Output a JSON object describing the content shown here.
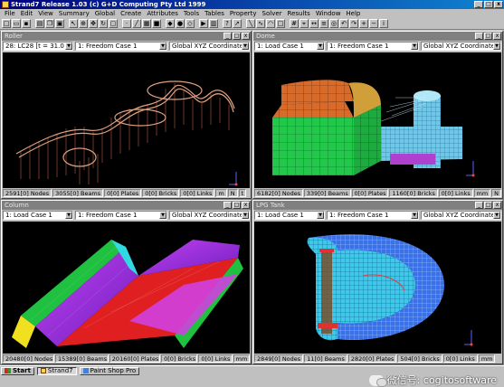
{
  "app": {
    "title": "Strand7 Release 1.03 (c) G+D Computing Pty Ltd 1999",
    "window_buttons": [
      "_",
      "□",
      "x"
    ]
  },
  "menu": [
    {
      "label": "File"
    },
    {
      "label": "Edit"
    },
    {
      "label": "View"
    },
    {
      "label": "Summary"
    },
    {
      "label": "Global"
    },
    {
      "label": "Create"
    },
    {
      "label": "Attributes"
    },
    {
      "label": "Tools"
    },
    {
      "label": "Tables"
    },
    {
      "label": "Property"
    },
    {
      "label": "Solver"
    },
    {
      "label": "Results"
    },
    {
      "label": "Window"
    },
    {
      "label": "Help"
    }
  ],
  "toolbar_icons": [
    "new-icon",
    "open-icon",
    "save-icon",
    "sep",
    "print-icon",
    "copy-icon",
    "paste-icon",
    "sep",
    "select-icon",
    "zoom-icon",
    "pan-icon",
    "rotate-icon",
    "fit-icon",
    "sep",
    "node-icon",
    "beam-icon",
    "plate-icon",
    "brick-icon",
    "sep",
    "render-icon",
    "solid-icon",
    "wire-icon",
    "sep",
    "solver-icon",
    "results-icon",
    "sep",
    "help-icon",
    "pointer-icon",
    "sep",
    "line-icon",
    "curve-icon",
    "arc-icon",
    "box-icon",
    "sep",
    "grid-icon",
    "snap-icon",
    "measure-icon",
    "layer-icon",
    "view-icon",
    "undo-icon",
    "redo-icon",
    "zoomin-icon",
    "zoomout-icon",
    "info-icon"
  ],
  "windows": [
    {
      "title": "Roller",
      "combo1": "28: LC28 [t = 31.0 s]",
      "combo2": "1: Freedom Case 1",
      "combo3": "Global XYZ Coordinate Sy",
      "status": [
        "2591[0] Nodes",
        "3055[0] Beams",
        "0[0] Plates",
        "0[0] Bricks",
        "0[0] Links",
        "m",
        "N",
        "t"
      ]
    },
    {
      "title": "Dome",
      "combo1": "1: Load Case 1",
      "combo2": "1: Freedom Case 1",
      "combo3": "Global XYZ Coordinate Sy",
      "status": [
        "6182[0] Nodes",
        "339[0] Beams",
        "0[0] Plates",
        "1160[0] Bricks",
        "0[0] Links",
        "mm",
        "N"
      ]
    },
    {
      "title": "Column",
      "combo1": "1: Load Case 1",
      "combo2": "1: Freedom Case 1",
      "combo3": "Global XYZ Coordinate Sy",
      "status": [
        "20480[0] Nodes",
        "15389[0] Beams",
        "20160[0] Plates",
        "0[0] Bricks",
        "0[0] Links",
        "mm"
      ]
    },
    {
      "title": "LPG Tank",
      "combo1": "1: Load Case 1",
      "combo2": "1: Freedom Case 1",
      "combo3": "Global XYZ Coordinate Sy",
      "status": [
        "2849[0] Nodes",
        "11[0] Beams",
        "2820[0] Plates",
        "504[0] Bricks",
        "0[0] Links",
        "mm"
      ]
    }
  ],
  "taskbar": {
    "start": "Start",
    "items": [
      "Strand7",
      "Paint Shop Pro"
    ]
  },
  "watermark": "微信号: cogitosoftware",
  "colors": {
    "title_active": "#000080",
    "title_inactive": "#808080",
    "face": "#c0c0c0",
    "viewport": "#000000"
  }
}
